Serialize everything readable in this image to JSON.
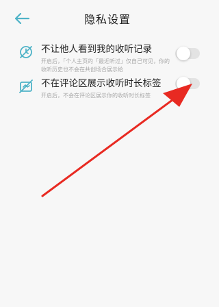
{
  "header": {
    "title": "隐私设置",
    "back_icon": "arrow-left-icon"
  },
  "colors": {
    "accent": "#4fb3c7",
    "toggle_off": "#e3e3e3",
    "annotation": "#e82a22"
  },
  "settings": [
    {
      "title": "不让他人看到我的收听记录",
      "description": "开启后，「个人主页的「最近听过」仅自己可见，你的收听历史也不会在共创场合展示给",
      "icon": "hidden-history-icon",
      "enabled": false
    },
    {
      "title": "不在评论区展示收听时长标签",
      "description": "开启后，不会在评论区展示你的收听时长标签",
      "icon": "hidden-tag-icon",
      "enabled": false
    }
  ],
  "annotation": {
    "type": "red-arrow",
    "points_to": "toggle-hide-listening-duration-tag"
  }
}
